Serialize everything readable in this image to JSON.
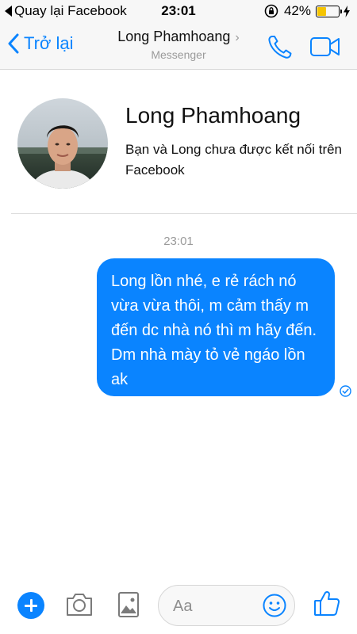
{
  "status_bar": {
    "back_app": "Quay lại Facebook",
    "time": "23:01",
    "battery": "42%",
    "battery_level": 0.42,
    "battery_color": "#f5c400"
  },
  "header": {
    "back_label": "Trở lại",
    "contact_name": "Long Phamhoang",
    "subtitle": "Messenger",
    "icons": [
      "chevron-left-icon",
      "chevron-right-icon",
      "phone-icon",
      "video-camera-icon"
    ]
  },
  "profile": {
    "name": "Long Phamhoang",
    "connection_note": "Bạn và Long chưa được kết nối trên Facebook"
  },
  "conversation": {
    "timestamp": "23:01",
    "messages": [
      {
        "sender": "me",
        "text": "Long lồn nhé, e rẻ rách nó vừa vừa thôi, m cảm thấy m đến dc nhà nó thì m hãy đến. Dm nhà mày tỏ vẻ ngáo lồn ak",
        "status_icon": "seen-check-icon"
      }
    ]
  },
  "composer": {
    "placeholder": "Aa",
    "icons": [
      "plus-icon",
      "camera-icon",
      "gallery-icon",
      "emoji-icon",
      "thumbs-up-icon"
    ]
  },
  "colors": {
    "accent": "#0a84ff",
    "bubble_text": "#ffffff",
    "muted_text": "#9a9a9a"
  }
}
